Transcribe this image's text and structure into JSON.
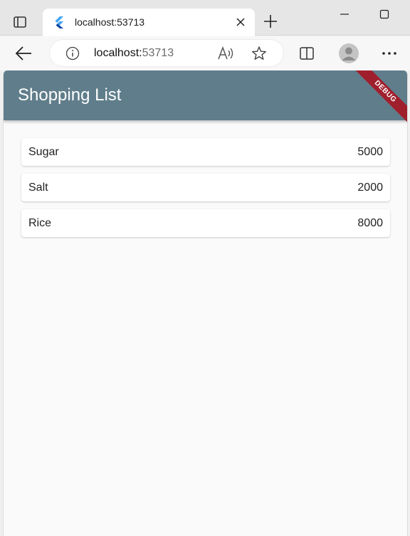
{
  "browser": {
    "tab_title": "localhost:53713",
    "url_host": "localhost:",
    "url_port": "53713"
  },
  "app": {
    "title": "Shopping List",
    "debug_banner": "DEBUG",
    "appbar_color": "#607d8b",
    "banner_color": "#a01f2c"
  },
  "items": [
    {
      "name": "Sugar",
      "quantity": "5000"
    },
    {
      "name": "Salt",
      "quantity": "2000"
    },
    {
      "name": "Rice",
      "quantity": "8000"
    }
  ],
  "icons": [
    "tab-actions-icon",
    "flutter-favicon-icon",
    "close-icon",
    "plus-icon",
    "minimize-icon",
    "maximize-icon",
    "back-arrow-icon",
    "info-icon",
    "read-aloud-icon",
    "star-icon",
    "split-screen-icon",
    "profile-icon",
    "more-icon"
  ]
}
